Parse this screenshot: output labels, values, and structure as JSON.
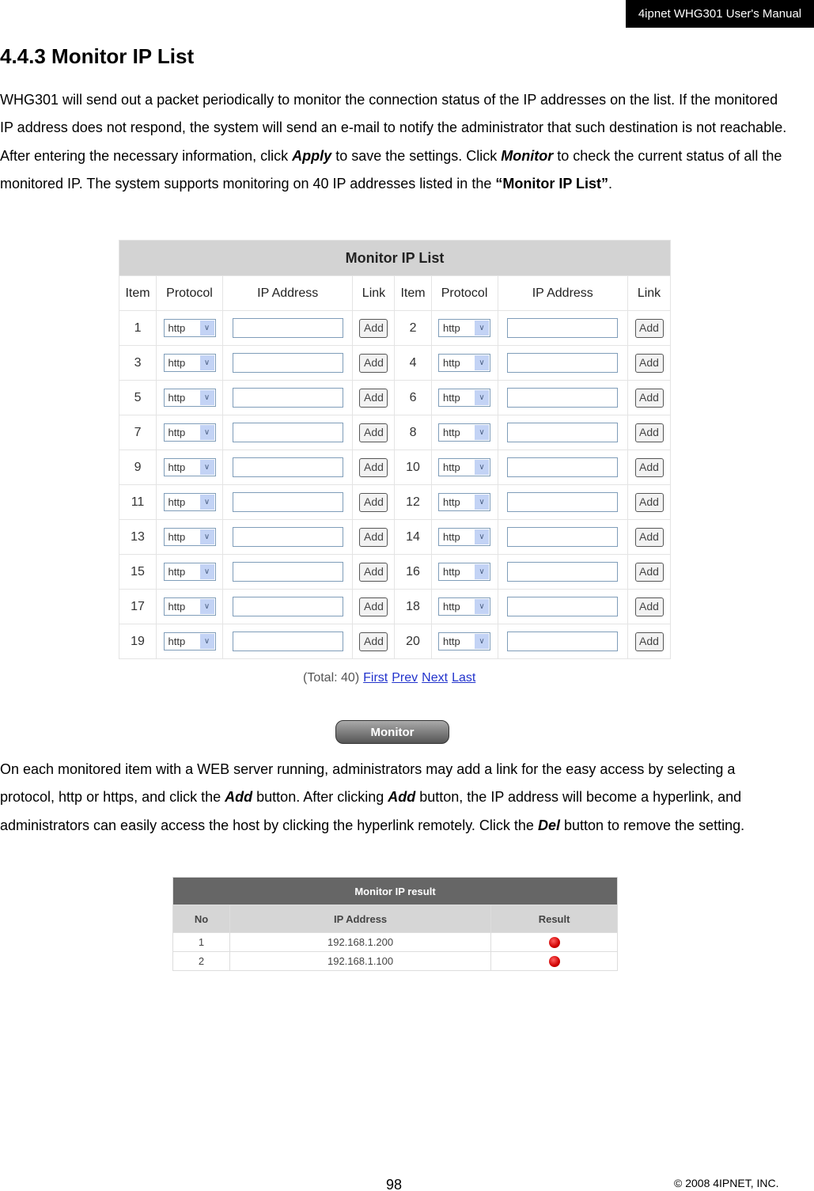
{
  "header": {
    "manual_title": "4ipnet WHG301 User's Manual"
  },
  "section_title": "4.4.3 Monitor IP List",
  "para1": {
    "t1": "WHG301 will send out a packet periodically to monitor the connection status of the IP addresses on the list. If the monitored IP address does not respond, the system will send an e-mail to notify the administrator that such destination is not reachable. After entering the necessary information, click ",
    "apply": "Apply",
    "t2": " to save the settings. Click ",
    "monitor": "Monitor",
    "t3": " to check the current status of all the monitored IP. The system supports monitoring on 40 IP addresses listed in the ",
    "list": "“Monitor IP List”",
    "t4": "."
  },
  "monitor_table": {
    "title": "Monitor IP List",
    "columns": [
      "Item",
      "Protocol",
      "IP Address",
      "Link",
      "Item",
      "Protocol",
      "IP Address",
      "Link"
    ],
    "protocol_value": "http",
    "add_label": "Add",
    "items": [
      1,
      2,
      3,
      4,
      5,
      6,
      7,
      8,
      9,
      10,
      11,
      12,
      13,
      14,
      15,
      16,
      17,
      18,
      19,
      20
    ]
  },
  "pager": {
    "total": "(Total: 40)",
    "first": "First",
    "prev": "Prev",
    "next": "Next",
    "last": "Last"
  },
  "monitor_button": "Monitor",
  "para2": {
    "t1": "On each monitored item with a WEB server running, administrators may add a link for the easy access by selecting a protocol, http or https, and click the ",
    "add": "Add",
    "t2": " button. After clicking ",
    "add2": "Add",
    "t3": " button, the IP address will become a hyperlink, and administrators can easily access the host by clicking the hyperlink remotely. Click the ",
    "del": "Del",
    "t4": " button to remove the setting."
  },
  "result_table": {
    "title": "Monitor IP result",
    "columns": [
      "No",
      "IP Address",
      "Result"
    ],
    "rows": [
      {
        "no": "1",
        "ip": "192.168.1.200",
        "status": "down",
        "color": "#d00000"
      },
      {
        "no": "2",
        "ip": "192.168.1.100",
        "status": "down",
        "color": "#d00000"
      }
    ]
  },
  "footer": {
    "page_number": "98",
    "copyright": "© 2008 4IPNET, INC."
  }
}
